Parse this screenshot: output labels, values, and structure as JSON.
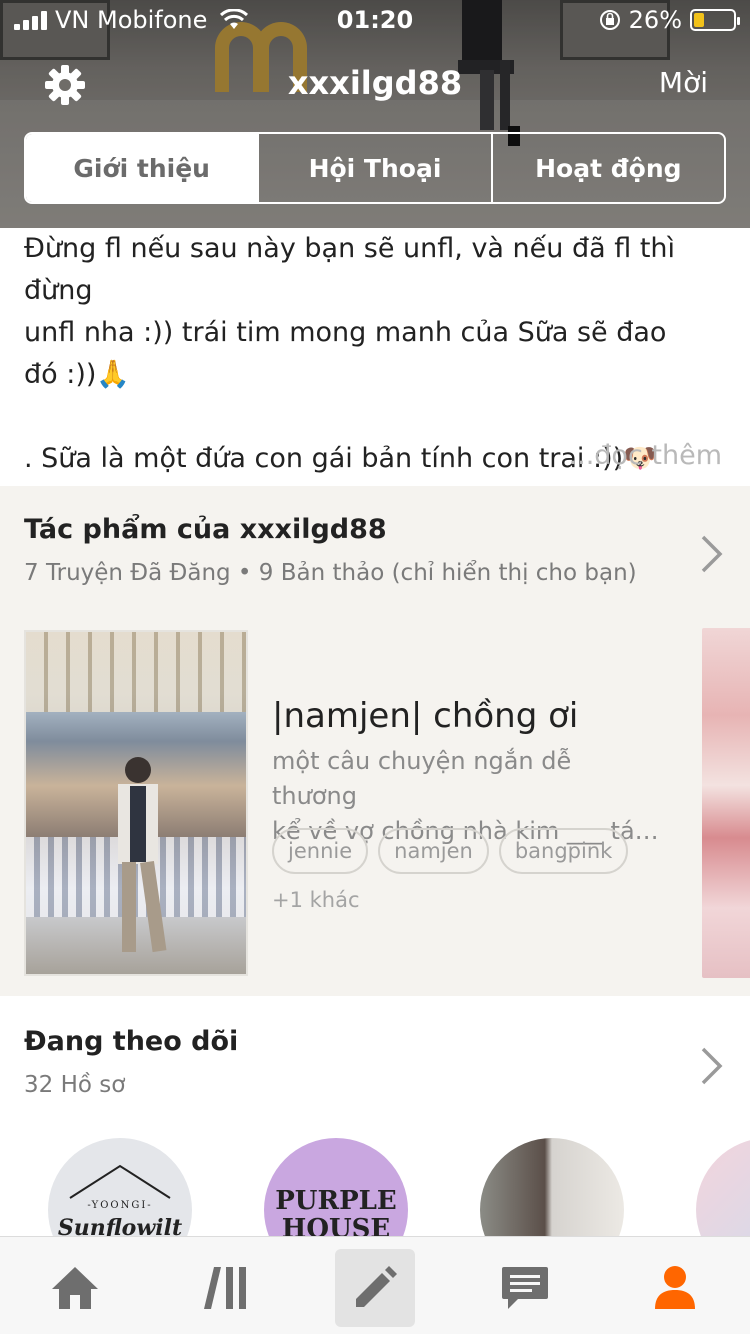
{
  "status_bar": {
    "carrier": "VN Mobifone",
    "time": "01:20",
    "battery_percent": "26%",
    "battery_level": 0.26
  },
  "header": {
    "username": "xxxilgd88",
    "invite_label": "Mời",
    "settings_icon": "gear-icon"
  },
  "tabs": [
    {
      "label": "Giới thiệu",
      "active": true
    },
    {
      "label": "Hội Thoại",
      "active": false
    },
    {
      "label": "Hoạt động",
      "active": false
    }
  ],
  "bio": {
    "line1": "Đừng fl nếu sau này bạn sẽ unfl, và nếu đã fl thì đừng",
    "line2": "unfl nha :)) trái tim mong manh của Sữa sẽ đao",
    "line3": "đó :))🙏",
    "line4": ". Sữa là một đứa con gái bản tính con trai :))🐶",
    "read_more": "...đọc thêm"
  },
  "works": {
    "title": "Tác phẩm của xxxilgd88",
    "subtitle": "7 Truyện Đã Đăng • 9 Bản thảo (chỉ hiển thị cho bạn)",
    "story": {
      "title": "|namjen| chồng ơi",
      "desc_line1": "một câu chuyện ngắn dễ thương",
      "desc_line2": "kể về vợ chồng nhà kim ___ tá…",
      "tags": [
        "jennie",
        "namjen",
        "bangpink"
      ],
      "more_tags": "+1 khác"
    }
  },
  "following": {
    "title": "Đang theo dõi",
    "subtitle": "32 Hồ sơ",
    "avatar1_small": "-YOONGI-",
    "avatar1_text": "Sunflowilt",
    "avatar2_line1": "PURPLE",
    "avatar2_line2": "HOUSE"
  },
  "bottom_nav": [
    {
      "icon": "home-icon"
    },
    {
      "icon": "library-icon"
    },
    {
      "icon": "pencil-icon"
    },
    {
      "icon": "message-icon"
    },
    {
      "icon": "profile-icon"
    }
  ],
  "colors": {
    "accent": "#ff6600",
    "nav_icon": "#6e6e6e",
    "section_bg": "#f5f3ef"
  }
}
